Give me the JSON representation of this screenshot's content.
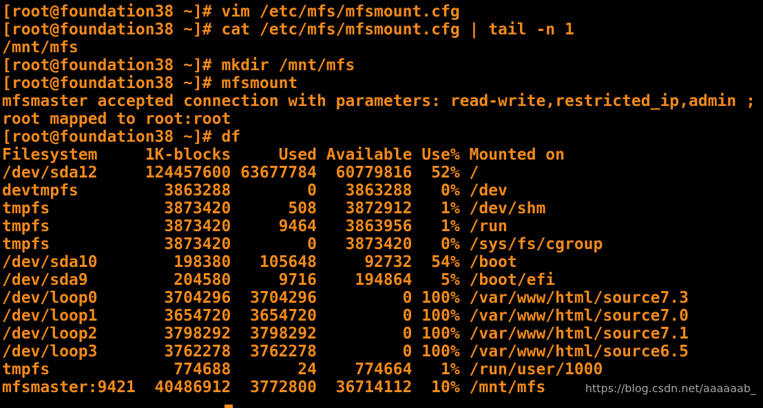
{
  "terminal": {
    "lines": [
      "[root@foundation38 ~]# vim /etc/mfs/mfsmount.cfg",
      "[root@foundation38 ~]# cat /etc/mfs/mfsmount.cfg | tail -n 1",
      "/mnt/mfs",
      "[root@foundation38 ~]# mkdir /mnt/mfs",
      "[root@foundation38 ~]# mfsmount",
      "mfsmaster accepted connection with parameters: read-write,restricted_ip,admin ;",
      "root mapped to root:root",
      "[root@foundation38 ~]# df",
      "Filesystem     1K-blocks     Used Available Use% Mounted on",
      "/dev/sda12     124457600 63677784  60779816  52% /",
      "devtmpfs         3863288        0   3863288   0% /dev",
      "tmpfs            3873420      508   3872912   1% /dev/shm",
      "tmpfs            3873420     9464   3863956   1% /run",
      "tmpfs            3873420        0   3873420   0% /sys/fs/cgroup",
      "/dev/sda10        198380   105648     92732  54% /boot",
      "/dev/sda9         204580     9716    194864   5% /boot/efi",
      "/dev/loop0       3704296  3704296         0 100% /var/www/html/source7.3",
      "/dev/loop1       3654720  3654720         0 100% /var/www/html/source7.0",
      "/dev/loop2       3798292  3798292         0 100% /var/www/html/source7.1",
      "/dev/loop3       3762278  3762278         0 100% /var/www/html/source6.5",
      "tmpfs             774688       24    774664   1% /run/user/1000",
      "mfsmaster:9421  40486912  3772800  36714112  10% /mnt/mfs"
    ]
  },
  "watermark": "https://blog.csdn.net/aaaaaab_",
  "colors": {
    "background": "#000000",
    "foreground": "#f28a1c",
    "watermark": "#bfbfbf"
  }
}
